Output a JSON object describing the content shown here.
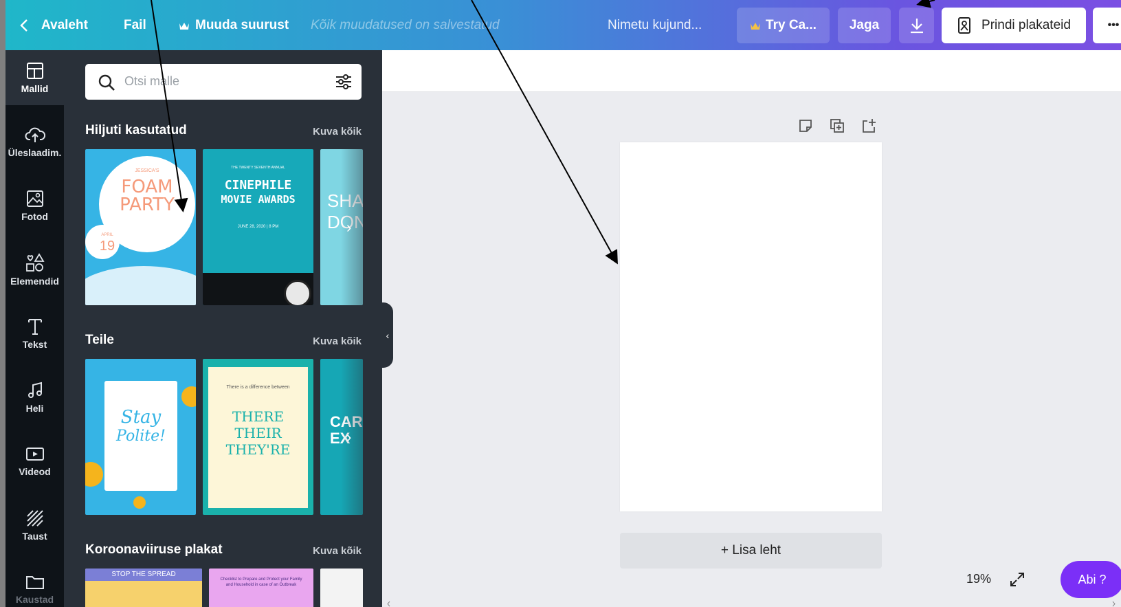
{
  "colors": {
    "accent": "#7b2ff7",
    "rail_bg": "#0e1318",
    "panel_bg": "#293039",
    "canvas_bg": "#ebecf0"
  },
  "topbar": {
    "back_label": "Avaleht",
    "file_label": "Fail",
    "resize_label": "Muuda suurust",
    "status": "Kõik muudatused on salvestatud",
    "design_name": "Nimetu kujund...",
    "try_label": "Try Ca...",
    "share_label": "Jaga",
    "print_label": "Prindi plakateid",
    "more_label": "•••"
  },
  "rail": {
    "items": [
      {
        "label": "Mallid",
        "icon": "template-icon"
      },
      {
        "label": "Üleslaadim.",
        "icon": "upload-icon"
      },
      {
        "label": "Fotod",
        "icon": "photo-icon"
      },
      {
        "label": "Elemendid",
        "icon": "shapes-icon"
      },
      {
        "label": "Tekst",
        "icon": "text-icon"
      },
      {
        "label": "Heli",
        "icon": "music-icon"
      },
      {
        "label": "Videod",
        "icon": "video-icon"
      },
      {
        "label": "Taust",
        "icon": "background-icon"
      },
      {
        "label": "Kaustad",
        "icon": "folder-icon"
      }
    ]
  },
  "panel": {
    "search_placeholder": "Otsi malle",
    "sections": [
      {
        "title": "Hiljuti kasutatud",
        "link": "Kuva kõik"
      },
      {
        "title": "Teile",
        "link": "Kuva kõik"
      },
      {
        "title": "Koroonaviiruse plakat",
        "link": "Kuva kõik"
      }
    ],
    "templates": {
      "foam": {
        "top": "JESSICA'S",
        "line1": "FOAM",
        "line2": "PARTY",
        "month": "APRIL",
        "day": "19"
      },
      "cinephile": {
        "small": "THE TWENTY SEVENTH ANNUAL",
        "line1": "CINEPHILE",
        "line2": "MOVIE AWARDS",
        "date": "JUNE 28, 2020 | 8 PM"
      },
      "shark": {
        "text": "SHA DON"
      },
      "polite": {
        "line1": "Stay",
        "line2": "Polite!"
      },
      "their": {
        "small": "There is a difference between",
        "line1": "THERE",
        "line2": "THEIR",
        "line3": "THEY'RE"
      },
      "car": {
        "text": "CAR EX"
      },
      "spread": {
        "text": "STOP THE SPREAD"
      },
      "checklist": {
        "text": "Checklist to Prepare and Protect your Family and Household in case of an Outbreak"
      }
    }
  },
  "canvas": {
    "add_page_label": "+ Lisa leht"
  },
  "footer": {
    "zoom": "19%",
    "help_label": "Abi ?"
  }
}
